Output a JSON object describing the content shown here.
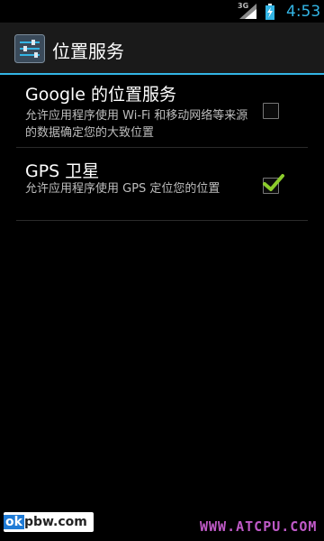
{
  "status_bar": {
    "network_type": "3G",
    "time": "4:53"
  },
  "action_bar": {
    "title": "位置服务",
    "icon": "settings-sliders-icon"
  },
  "preferences": [
    {
      "title": "Google 的位置服务",
      "summary": "允许应用程序使用 Wi-Fi 和移动网络等来源的数据确定您的大致位置",
      "checked": false
    },
    {
      "title": "GPS 卫星",
      "summary": "允许应用程序使用 GPS 定位您的位置",
      "checked": true
    }
  ],
  "watermarks": {
    "left_ok": "ok",
    "left_rest": "pbw.com",
    "right": "WWW.ATCPU.COM"
  },
  "colors": {
    "accent": "#33b5e5",
    "check_mark": "#8ccc2c",
    "background": "#000000"
  }
}
